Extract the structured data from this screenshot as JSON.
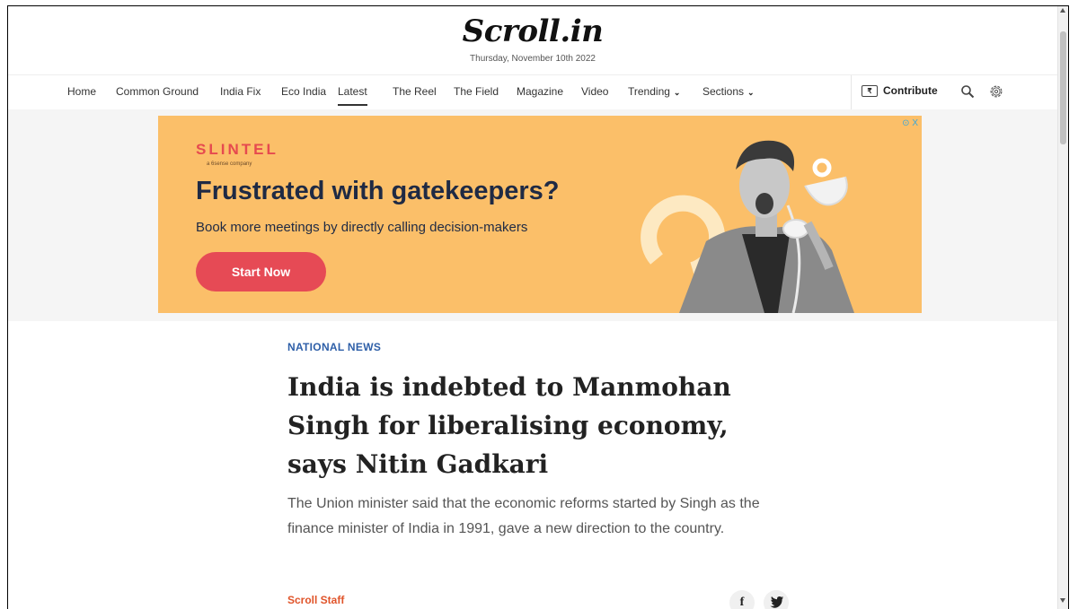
{
  "masthead": {
    "logo": "Scroll.in",
    "date": "Thursday, November 10th 2022"
  },
  "nav": {
    "items": [
      {
        "label": "Home"
      },
      {
        "label": "Common Ground"
      },
      {
        "label": "India Fix"
      },
      {
        "label": "Eco India"
      },
      {
        "label": "Latest",
        "active": true
      },
      {
        "label": "The Reel"
      },
      {
        "label": "The Field"
      },
      {
        "label": "Magazine"
      },
      {
        "label": "Video"
      },
      {
        "label": "Trending",
        "has_dropdown": true
      },
      {
        "label": "Sections",
        "has_dropdown": true
      }
    ],
    "contribute_label": "Contribute",
    "contribute_icon": "₹",
    "icons": [
      "search-icon",
      "gear-icon"
    ]
  },
  "ad": {
    "brand": "SLINTEL",
    "brand_sub": "a 6sense company",
    "headline": "Frustrated with gatekeepers?",
    "body": "Book more meetings by directly calling decision-makers",
    "cta": "Start Now",
    "choices": "⊙ X",
    "colors": {
      "background": "#fbbf69",
      "brand": "#e64a4f",
      "cta": "#e64a55",
      "text": "#1f2a44"
    }
  },
  "article": {
    "section": "NATIONAL NEWS",
    "headline": "India is indebted to Manmohan Singh for liberalising economy, says Nitin Gadkari",
    "standfirst": "The Union minister said that the economic reforms started by Singh as the finance minister of India in 1991, gave a new direction to the country.",
    "byline": "Scroll Staff",
    "share": {
      "facebook": "f"
    },
    "colors": {
      "section": "#2e5fa8",
      "byline": "#e0542a"
    }
  }
}
